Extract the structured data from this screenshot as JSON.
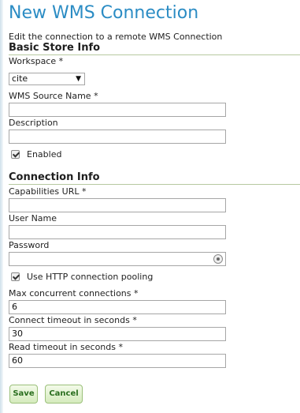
{
  "page": {
    "title": "New WMS Connection",
    "subtitle": "Edit the connection to a remote WMS Connection"
  },
  "basic_store": {
    "heading": "Basic Store Info",
    "workspace_label": "Workspace *",
    "workspace_value": "cite",
    "source_name_label": "WMS Source Name *",
    "source_name_value": "",
    "description_label": "Description",
    "description_value": "",
    "enabled_label": "Enabled",
    "enabled_checked": true
  },
  "connection": {
    "heading": "Connection Info",
    "capabilities_label": "Capabilities URL *",
    "capabilities_value": "",
    "username_label": "User Name",
    "username_value": "",
    "password_label": "Password",
    "password_value": "",
    "pooling_label": "Use HTTP connection pooling",
    "pooling_checked": true,
    "max_conn_label": "Max concurrent connections *",
    "max_conn_value": "6",
    "connect_timeout_label": "Connect timeout in seconds *",
    "connect_timeout_value": "30",
    "read_timeout_label": "Read timeout in seconds *",
    "read_timeout_value": "60"
  },
  "actions": {
    "save_label": "Save",
    "cancel_label": "Cancel"
  },
  "colors": {
    "title": "#2b8cc4",
    "button_text": "#2a6e1e",
    "section_rule": "#b7c9a0"
  }
}
